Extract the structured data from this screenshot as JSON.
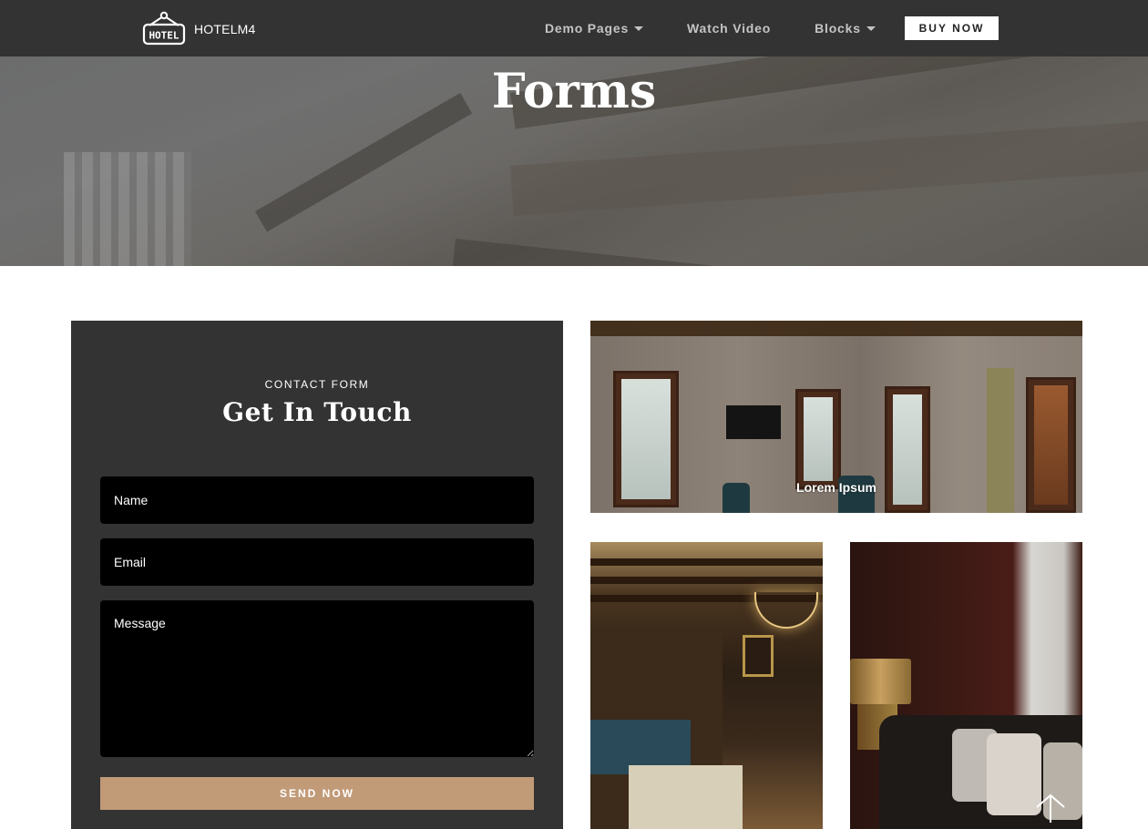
{
  "navbar": {
    "brand_logo_text": "HOTEL",
    "brand_name": "HOTELM4",
    "links": [
      {
        "label": "Demo Pages",
        "has_dropdown": true
      },
      {
        "label": "Watch Video",
        "has_dropdown": false
      },
      {
        "label": "Blocks",
        "has_dropdown": true
      }
    ],
    "cta_label": "BUY NOW"
  },
  "hero": {
    "title": "Forms"
  },
  "contact_form": {
    "eyebrow": "CONTACT FORM",
    "title": "Get In Touch",
    "fields": {
      "name": {
        "placeholder": "Name",
        "value": ""
      },
      "email": {
        "placeholder": "Email",
        "value": ""
      },
      "message": {
        "placeholder": "Message",
        "value": ""
      }
    },
    "submit_label": "SEND NOW",
    "submit_color": "#c19a78"
  },
  "gallery": {
    "images": [
      {
        "alt": "Stone-walled hotel room with wooden windows",
        "caption": "Lorem Ipsum"
      },
      {
        "alt": "Wood-panelled bedroom with four-poster bed and chandelier",
        "caption": ""
      },
      {
        "alt": "Dark lounge corner with brass lamp and sofa cushions",
        "caption": ""
      }
    ]
  },
  "scroll_top": {
    "icon": "arrow-up-icon"
  },
  "colors": {
    "navbar_bg": "#333333",
    "panel_bg": "#333333",
    "field_bg": "#000000",
    "accent": "#c19a78"
  }
}
